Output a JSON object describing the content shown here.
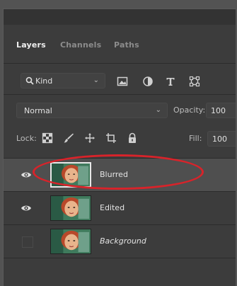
{
  "panel": {
    "tabs": [
      {
        "label": "Layers",
        "active": true
      },
      {
        "label": "Channels",
        "active": false
      },
      {
        "label": "Paths",
        "active": false
      }
    ]
  },
  "filter": {
    "kind_label": "Kind",
    "icons": [
      "image-filter-icon",
      "adjustment-filter-icon",
      "type-filter-icon",
      "shape-filter-icon"
    ]
  },
  "blend": {
    "mode": "Normal",
    "opacity_label": "Opacity:",
    "opacity_value": "100"
  },
  "lock": {
    "label": "Lock:",
    "icons": [
      "lock-transparent-icon",
      "lock-paint-icon",
      "lock-move-icon",
      "lock-artboard-icon",
      "lock-all-icon"
    ],
    "fill_label": "Fill:",
    "fill_value": "100"
  },
  "layers": [
    {
      "name": "Blurred",
      "visible": true,
      "selected": true,
      "italic": false
    },
    {
      "name": "Edited",
      "visible": true,
      "selected": false,
      "italic": false
    },
    {
      "name": "Background",
      "visible": false,
      "selected": false,
      "italic": true
    }
  ],
  "colors": {
    "panel_bg": "#3c3c3c",
    "selected_row": "#4f4f4f",
    "annotation_red": "#d8232a"
  }
}
